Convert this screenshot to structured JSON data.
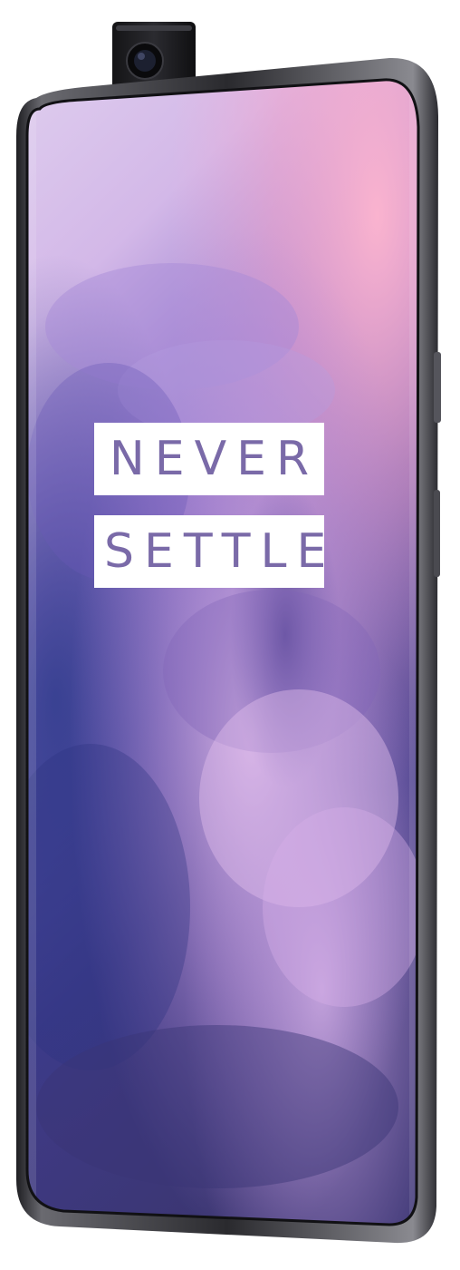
{
  "product": {
    "tagline_line1": "NEVER",
    "tagline_line2": "SETTLE"
  },
  "colors": {
    "frame": "#3a3a3f",
    "screen_top_left": "#d8c8ee",
    "screen_top_right": "#f7b8d2",
    "screen_mid_purple": "#8a6cc4",
    "screen_deep_blue": "#3f3a86",
    "screen_bottom": "#3a3570",
    "logo_box": "#ffffff",
    "logo_text": "#7a6aa8"
  },
  "icons": {
    "camera": "popup-camera-icon"
  }
}
